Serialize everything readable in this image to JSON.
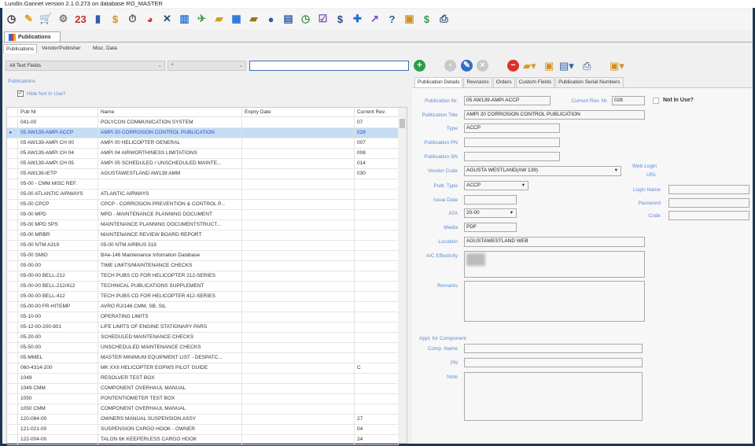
{
  "window": {
    "title": "Lundin.Gannet version 2.1.0.273 on database RO_MASTER"
  },
  "toolbar": [
    {
      "name": "clock-icon",
      "glyph": "◷",
      "color": "#333"
    },
    {
      "name": "notepad-edit-icon",
      "glyph": "✎",
      "color": "#e0a020"
    },
    {
      "name": "cart-icon",
      "glyph": "🛒",
      "color": "#2a4a80"
    },
    {
      "name": "gears-icon",
      "glyph": "⚙",
      "color": "#777"
    },
    {
      "name": "calendar-icon",
      "glyph": "23",
      "color": "#b33"
    },
    {
      "name": "book-pen-icon",
      "glyph": "▮",
      "color": "#2e5fa8"
    },
    {
      "name": "document-dollar-icon",
      "glyph": "$",
      "color": "#d09020"
    },
    {
      "name": "stopwatch-icon",
      "glyph": "⏱",
      "color": "#555"
    },
    {
      "name": "pie-chart-icon",
      "glyph": "◕",
      "color": "#c33"
    },
    {
      "name": "tools-icon",
      "glyph": "✕",
      "color": "#2a4a80"
    },
    {
      "name": "books-icon",
      "glyph": "▥",
      "color": "#1e6fd9"
    },
    {
      "name": "plane-icon",
      "glyph": "✈",
      "color": "#3a9a4a"
    },
    {
      "name": "folder-info-icon",
      "glyph": "▰",
      "color": "#d89a20"
    },
    {
      "name": "grid-icon",
      "glyph": "▦",
      "color": "#1e6fd9"
    },
    {
      "name": "folder-settings-icon",
      "glyph": "▰",
      "color": "#a07020"
    },
    {
      "name": "user-icon",
      "glyph": "●",
      "color": "#2e5fa8"
    },
    {
      "name": "id-card-icon",
      "glyph": "▤",
      "color": "#2e5fa8"
    },
    {
      "name": "clock-add-icon",
      "glyph": "◷",
      "color": "#3a9a4a"
    },
    {
      "name": "checklist-icon",
      "glyph": "☑",
      "color": "#7a4ac0"
    },
    {
      "name": "dollar-icon",
      "glyph": "$",
      "color": "#2a4a80"
    },
    {
      "name": "puzzle-icon",
      "glyph": "✚",
      "color": "#1e6fd9"
    },
    {
      "name": "chart-edit-icon",
      "glyph": "↗",
      "color": "#7a4ac0"
    },
    {
      "name": "help-icon",
      "glyph": "?",
      "color": "#2e5fa8"
    },
    {
      "name": "clipboard-icon",
      "glyph": "▣",
      "color": "#d09020"
    },
    {
      "name": "phone-icon",
      "glyph": "$",
      "color": "#3a9a4a"
    },
    {
      "name": "printer-icon",
      "glyph": "⎙",
      "color": "#2a4a80"
    }
  ],
  "doc_tab": "Publications",
  "subtabs": [
    "Publications",
    "Vendor/Publisher",
    "Misc. Data"
  ],
  "filter": {
    "field": "All Text Fields",
    "operator": "*",
    "search_value": ""
  },
  "left": {
    "section_title": "Publications",
    "hide_not_in_use": "Hide Not In Use?",
    "columns": [
      "Pub Nr",
      "Name",
      "Expiry Date",
      "Current Rev."
    ],
    "rows": [
      [
        "041-00",
        "POLYCON COMMUNICATION SYSTEM",
        "",
        "07"
      ],
      [
        "05 AW139-AMPI ACCP",
        "AMPI 20 CORROSION CONTROL PUBLICATION",
        "",
        "028"
      ],
      [
        "05 AW139-AMPI CH 00",
        "AMPI 00 HELICOPTER GENERAL",
        "",
        "007"
      ],
      [
        "05 AW139-AMPI CH 04",
        "AMPI 04 AIRWORTHINESS LIMITATIONS",
        "",
        "008"
      ],
      [
        "05 AW139-AMPI CH 05",
        "AMPI 05 SCHEDULED / UNSCHEDULED MAINTE...",
        "",
        "014"
      ],
      [
        "05 AW139-IETP",
        "AGUSTAWESTLAND AW139 AMM",
        "",
        "030"
      ],
      [
        "05-00 - CMM MISC REF.",
        "",
        "",
        ""
      ],
      [
        "05-00 ATLANTIC AIRWAYS",
        "ATLANTIC AIRWAYS",
        "",
        ""
      ],
      [
        "05-00 CPCP",
        "CPCP - CORROSION PREVENTION & CONTROL P...",
        "",
        ""
      ],
      [
        "05-00 MPD",
        "MPD - MAINTENANCE PLANNING DOCUMENT",
        "",
        ""
      ],
      [
        "05-00 MPD SPS",
        "MAINTENANCE PLANNING DOCUMENTSTRUCT...",
        "",
        ""
      ],
      [
        "05-00 MRBR",
        "MAINTENANCE REVIEW BOARD REPORT",
        "",
        ""
      ],
      [
        "05-00 NTM A319",
        "05-00 NTM AIRBUS 319",
        "",
        ""
      ],
      [
        "05-00 SMID",
        "BAe-146 Maintenance Infomation Database",
        "",
        ""
      ],
      [
        "05-00-00",
        "TIME LIMITS/MAINTENANCE CHECKS",
        "",
        ""
      ],
      [
        "05-00-00 BELL-212",
        "TECH PUBS CD FOR HELICOPTER 212-SERIES",
        "",
        ""
      ],
      [
        "05-00-00 BELL-212/412",
        "TECHNICAL PUBLICATIONS SUPPLEMENT",
        "",
        ""
      ],
      [
        "05-00-00 BELL-412",
        "TECH PUBS CD FOR HELICOPTER 412-SERIES",
        "",
        ""
      ],
      [
        "05-00-00 FR-HITEMP",
        "AVRO RJ/146 CMM, SB, SIL",
        "",
        ""
      ],
      [
        "05-10-00",
        "OPERATING LIMITS",
        "",
        ""
      ],
      [
        "05-12-00-200-801",
        "LIFE LIMITS OF ENGINE STATIONARY PARS",
        "",
        ""
      ],
      [
        "05-20-00",
        "SCHEDULED MAINTENANCE CHECKS",
        "",
        ""
      ],
      [
        "05-50-00",
        "UNSCHEDULED MAINTENANCE CHECKS",
        "",
        ""
      ],
      [
        "05-MMEL",
        "MASTER MINIMUM EQUIPMENT LIST - DESPATC...",
        "",
        ""
      ],
      [
        "060-4314-200",
        "MK XXII HELICOPTER EGPWS PILOT GUIDE",
        "",
        "C"
      ],
      [
        "1049",
        "RESOLVER TEST BOX",
        "",
        ""
      ],
      [
        "1049 CMM",
        "COMPONENT OVERHAUL MANUAL",
        "",
        ""
      ],
      [
        "1050",
        "PONTENTIOMETER TEST BOX",
        "",
        ""
      ],
      [
        "1050 CMM",
        "COMPONENT OVERHAUL MANUAL",
        "",
        ""
      ],
      [
        "120-084-00",
        "OWNERS MANUAL SUSPENSION ASSY",
        "",
        "27"
      ],
      [
        "121-021-00",
        "SUSPENSION CARGO HOOK - OWNER",
        "",
        "04"
      ],
      [
        "122-004-00",
        "TALON 6K KEEPERLESS CARGO HOOK",
        "",
        "24"
      ]
    ]
  },
  "right": {
    "tabs": [
      "Publication Details",
      "Revisions",
      "Orders",
      "Custom Fields",
      "Publication Serial Numbers"
    ],
    "labels": {
      "pub_nr": "Publication Nr.",
      "cur_rev": "Current Rev. Nr.",
      "not_in_use": "Not In Use?",
      "title": "Publication Title",
      "type": "Type",
      "pn": "Publication PN",
      "sn": "Publication SN",
      "vendor": "Vendor Code",
      "publ_type": "Publ. Type",
      "issue_date": "Issue Date",
      "ata": "ATA",
      "media": "Media",
      "location": "Location",
      "ac_eff": "A/C Effectivity",
      "remarks": "Remarks",
      "appl": "Appl. for Component",
      "comp_name": "Comp. Name",
      "comp_pn": "PN",
      "note": "Note",
      "web_login": "Web Login",
      "url": "URL",
      "login_name": "Login Name",
      "password": "Password",
      "code": "Code"
    },
    "values": {
      "pub_nr": "05 AW139-AMPI ACCP",
      "cur_rev": "028",
      "title": "AMPI 20 CORROSION CONTROL PUBLICATION",
      "type": "ACCP",
      "pn": "",
      "sn": "",
      "vendor": "AGUSTA WESTLAND(AW 139)",
      "publ_type": "ACCP",
      "issue_date": "",
      "ata": "20-00",
      "media": "PDF",
      "location": "AGUSTAWESTLAND WEB"
    }
  }
}
